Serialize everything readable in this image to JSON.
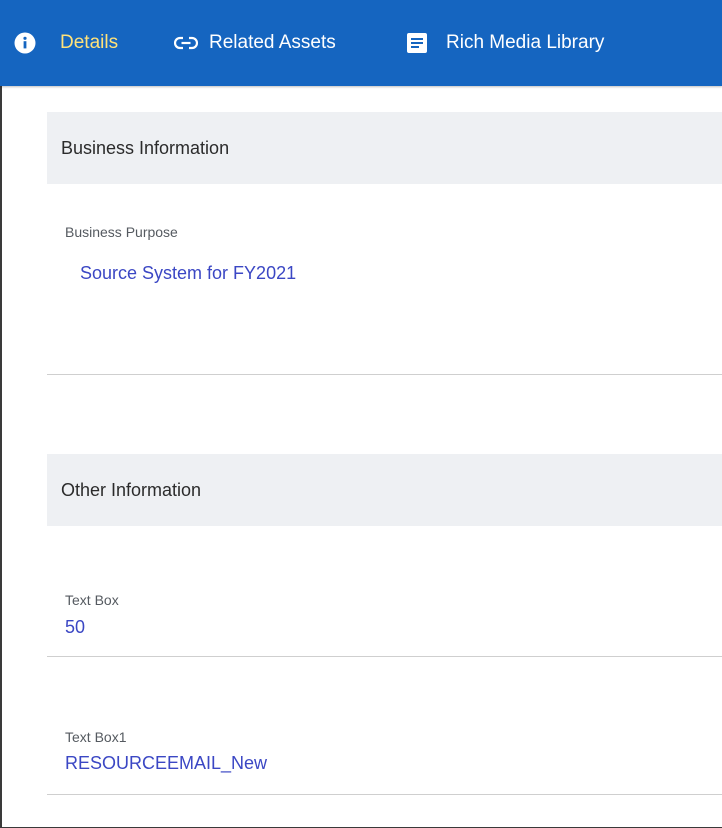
{
  "tabs": [
    {
      "label": "Details",
      "icon": "info-icon",
      "active": true
    },
    {
      "label": "Related Assets",
      "icon": "link-icon",
      "active": false
    },
    {
      "label": "Rich Media Library",
      "icon": "document-icon",
      "active": false
    }
  ],
  "sections": [
    {
      "title": "Business Information",
      "fields": [
        {
          "label": "Business Purpose",
          "value": "Source System for FY2021"
        }
      ]
    },
    {
      "title": "Other Information",
      "fields": [
        {
          "label": "Text Box",
          "value": "50"
        },
        {
          "label": "Text Box1",
          "value": "RESOURCEEMAIL_New"
        }
      ]
    }
  ],
  "colors": {
    "tabbar": "#1565c0",
    "active_tab_text": "#ffe27a",
    "field_value": "#3b47c4",
    "section_header_bg": "#eef0f3"
  }
}
